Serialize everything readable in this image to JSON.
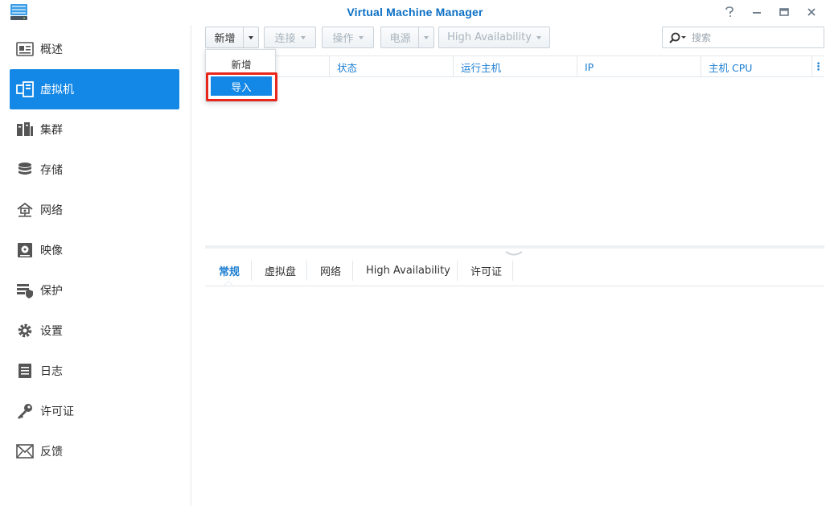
{
  "window": {
    "title": "Virtual Machine Manager"
  },
  "sidebar": {
    "items": [
      {
        "label": "概述",
        "icon": "overview-icon"
      },
      {
        "label": "虚拟机",
        "icon": "virtual-machine-icon",
        "active": true
      },
      {
        "label": "集群",
        "icon": "cluster-icon"
      },
      {
        "label": "存储",
        "icon": "storage-icon"
      },
      {
        "label": "网络",
        "icon": "network-icon"
      },
      {
        "label": "映像",
        "icon": "image-icon"
      },
      {
        "label": "保护",
        "icon": "protection-icon"
      },
      {
        "label": "设置",
        "icon": "gear-icon"
      },
      {
        "label": "日志",
        "icon": "log-icon"
      },
      {
        "label": "许可证",
        "icon": "key-icon"
      },
      {
        "label": "反馈",
        "icon": "envelope-icon"
      }
    ]
  },
  "toolbar": {
    "create_label": "新增",
    "connect_label": "连接",
    "action_label": "操作",
    "power_label": "电源",
    "ha_label": "High Availability",
    "search_placeholder": "搜索"
  },
  "grid": {
    "columns": [
      "状态",
      "运行主机",
      "IP",
      "主机 CPU"
    ]
  },
  "dropdown_menu": {
    "items": [
      "新增",
      "导入"
    ],
    "highlighted_index": 1
  },
  "detail_tabs": {
    "items": [
      "常规",
      "虚拟盘",
      "网络",
      "High Availability",
      "许可证"
    ],
    "active_index": 0
  },
  "colors": {
    "accent": "#1488e6",
    "title": "#0b6fc4",
    "header_text": "#1b7ed2",
    "annotation_box": "#e8261c"
  }
}
